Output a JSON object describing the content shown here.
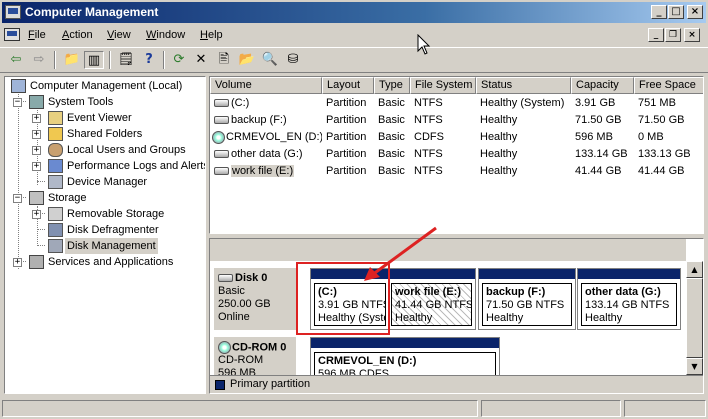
{
  "window": {
    "title": "Computer Management"
  },
  "menu": [
    {
      "label": "File",
      "u": "F",
      "rest": "ile"
    },
    {
      "label": "Action",
      "u": "A",
      "rest": "ction"
    },
    {
      "label": "View",
      "u": "V",
      "rest": "iew"
    },
    {
      "label": "Window",
      "u": "W",
      "rest": "indow"
    },
    {
      "label": "Help",
      "u": "H",
      "rest": "elp"
    }
  ],
  "toolbar": [
    "back-icon",
    "forward-icon",
    "up-folder-icon",
    "show-hide-tree-icon",
    "properties-icon",
    "help-icon",
    "refresh-icon",
    "delete-icon",
    "properties2-icon",
    "open-icon",
    "search-icon",
    "disk-properties-icon"
  ],
  "tree": {
    "root": "Computer Management (Local)",
    "items": [
      {
        "label": "System Tools"
      },
      {
        "label": "Event Viewer"
      },
      {
        "label": "Shared Folders"
      },
      {
        "label": "Local Users and Groups"
      },
      {
        "label": "Performance Logs and Alerts"
      },
      {
        "label": "Device Manager"
      },
      {
        "label": "Storage"
      },
      {
        "label": "Removable Storage"
      },
      {
        "label": "Disk Defragmenter"
      },
      {
        "label": "Disk Management"
      },
      {
        "label": "Services and Applications"
      }
    ]
  },
  "list": {
    "columns": [
      "Volume",
      "Layout",
      "Type",
      "File System",
      "Status",
      "Capacity",
      "Free Space"
    ],
    "rows": [
      {
        "volume": "(C:)",
        "layout": "Partition",
        "type": "Basic",
        "fs": "NTFS",
        "status": "Healthy (System)",
        "capacity": "3.91 GB",
        "free": "751 MB"
      },
      {
        "volume": "backup (F:)",
        "layout": "Partition",
        "type": "Basic",
        "fs": "NTFS",
        "status": "Healthy",
        "capacity": "71.50 GB",
        "free": "71.50 GB"
      },
      {
        "volume": "CRMEVOL_EN (D:)",
        "layout": "Partition",
        "type": "Basic",
        "fs": "CDFS",
        "status": "Healthy",
        "capacity": "596 MB",
        "free": "0 MB"
      },
      {
        "volume": "other data (G:)",
        "layout": "Partition",
        "type": "Basic",
        "fs": "NTFS",
        "status": "Healthy",
        "capacity": "133.14 GB",
        "free": "133.13 GB"
      },
      {
        "volume": "work file (E:)",
        "layout": "Partition",
        "type": "Basic",
        "fs": "NTFS",
        "status": "Healthy",
        "capacity": "41.44 GB",
        "free": "41.44 GB"
      }
    ]
  },
  "disks": [
    {
      "name": "Disk 0",
      "kind": "Basic",
      "size": "250.00 GB",
      "state": "Online",
      "partitions": [
        {
          "title": "(C:)",
          "line2": "3.91 GB NTFS",
          "line3": "Healthy (System)"
        },
        {
          "title": "work file  (E:)",
          "line2": "41.44 GB NTFS",
          "line3": "Healthy"
        },
        {
          "title": "backup  (F:)",
          "line2": "71.50 GB NTFS",
          "line3": "Healthy"
        },
        {
          "title": "other data  (G:)",
          "line2": "133.14 GB NTFS",
          "line3": "Healthy"
        }
      ]
    },
    {
      "name": "CD-ROM 0",
      "kind": "CD-ROM",
      "size": "596 MB",
      "partitions": [
        {
          "title": "CRMEVOL_EN  (D:)",
          "line2": "596 MB CDFS"
        }
      ]
    }
  ],
  "legend": {
    "label": "Primary partition",
    "color": "#0a246a"
  },
  "colors": {
    "titlebar": "#0a246a",
    "partition_bar": "#0a246a",
    "annotation": "#d22222"
  }
}
